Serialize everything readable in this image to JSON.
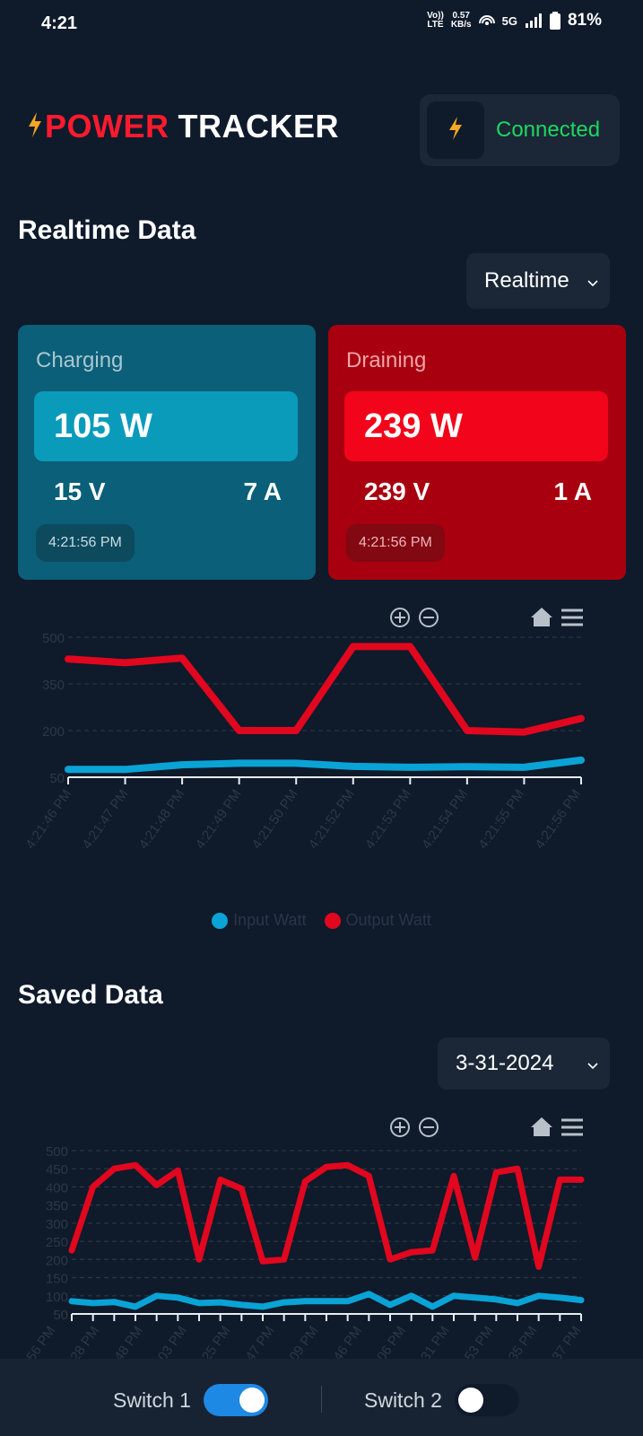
{
  "status_bar": {
    "time": "4:21",
    "lte_top": "Vo))",
    "lte_bottom": "LTE",
    "speed_top": "0.57",
    "speed_bottom": "KB/s",
    "network": "5G",
    "battery": "81%"
  },
  "header": {
    "logo_red": "POWER",
    "logo_white": "TRACKER",
    "connection_status": "Connected",
    "accent_yellow": "#f5a623",
    "connected_color": "#1ed760"
  },
  "realtime": {
    "title": "Realtime Data",
    "mode": "Realtime",
    "charging": {
      "title": "Charging",
      "watts": "105 W",
      "volts": "15 V",
      "amps": "7 A",
      "timestamp": "4:21:56 PM"
    },
    "draining": {
      "title": "Draining",
      "watts": "239 W",
      "volts": "239 V",
      "amps": "1 A",
      "timestamp": "4:21:56 PM"
    }
  },
  "chart_data": [
    {
      "type": "line",
      "ylim": [
        50,
        500
      ],
      "yticks": [
        "50",
        "200",
        "350",
        "500"
      ],
      "x": [
        "4:21:46 PM",
        "4:21:47 PM",
        "4:21:48 PM",
        "4:21:49 PM",
        "4:21:50 PM",
        "4:21:52 PM",
        "4:21:53 PM",
        "4:21:54 PM",
        "4:21:55 PM",
        "4:21:56 PM"
      ],
      "series": [
        {
          "name": "Input Watt",
          "color": "#0aa3d6",
          "values": [
            75,
            75,
            90,
            95,
            95,
            85,
            82,
            84,
            82,
            105
          ]
        },
        {
          "name": "Output Watt",
          "color": "#e0071e",
          "values": [
            430,
            418,
            433,
            200,
            200,
            470,
            470,
            200,
            195,
            239
          ]
        }
      ],
      "grid": true,
      "legend": "bottom-center",
      "toolbar": [
        "zoom-in",
        "zoom-out",
        "home",
        "menu"
      ]
    },
    {
      "type": "line",
      "ylim": [
        50,
        500
      ],
      "yticks": [
        "50",
        "100",
        "150",
        "200",
        "250",
        "300",
        "350",
        "400",
        "450",
        "500"
      ],
      "x": [
        "56 PM",
        "28 PM",
        "48 PM",
        "03 PM",
        "25 PM",
        "47 PM",
        "09 PM",
        "46 PM",
        "06 PM",
        "31 PM",
        "53 PM",
        "35 PM",
        "37 PM"
      ],
      "series": [
        {
          "name": "Input Watt",
          "color": "#0aa3d6",
          "values": [
            85,
            80,
            83,
            70,
            100,
            95,
            80,
            82,
            75,
            70,
            82,
            85,
            85,
            85,
            105,
            75,
            100,
            70,
            100,
            95,
            90,
            80,
            100,
            95,
            88
          ]
        },
        {
          "name": "Output Watt",
          "color": "#e0071e",
          "values": [
            225,
            400,
            450,
            460,
            405,
            445,
            200,
            420,
            395,
            195,
            200,
            415,
            455,
            460,
            430,
            200,
            220,
            225,
            430,
            205,
            440,
            450,
            180,
            420,
            420
          ]
        }
      ],
      "grid": true,
      "toolbar": [
        "zoom-in",
        "zoom-out",
        "home",
        "menu"
      ]
    }
  ],
  "saved": {
    "title": "Saved Data",
    "date": "3-31-2024"
  },
  "switches": {
    "switch1_label": "Switch 1",
    "switch1_on": true,
    "switch2_label": "Switch 2",
    "switch2_on": false
  }
}
